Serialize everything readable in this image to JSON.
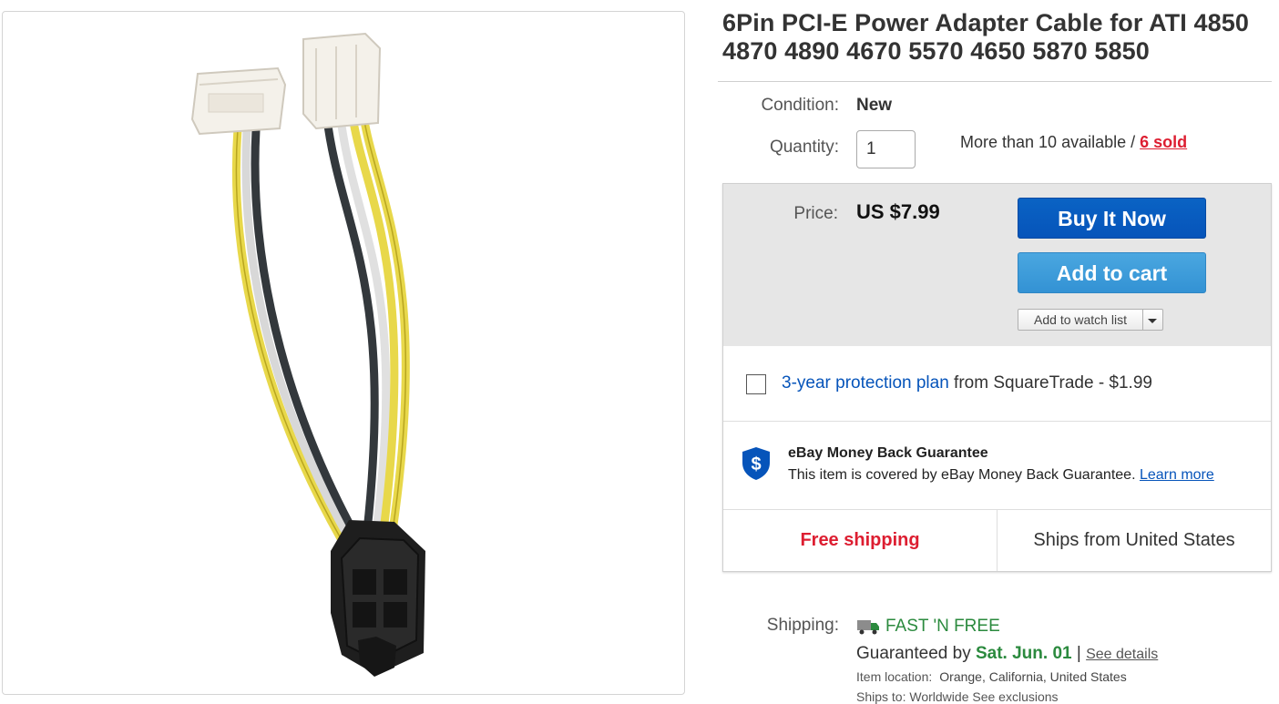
{
  "listing": {
    "title": "6Pin PCI-E Power Adapter Cable for ATI 4850 4870 4890 4670 5570 4650 5870 5850",
    "condition_label": "Condition:",
    "condition_value": "New",
    "quantity_label": "Quantity:",
    "quantity_value": "1",
    "availability_text": "More than 10 available / ",
    "sold_text": "6 sold"
  },
  "buybox": {
    "price_label": "Price:",
    "price_value": "US $7.99",
    "buy_now_label": "Buy It Now",
    "add_to_cart_label": "Add to cart",
    "watch_label": "Add to watch list",
    "protection_link": "3-year protection plan",
    "protection_rest": " from SquareTrade - $1.99",
    "mbg_title": "eBay Money Back Guarantee",
    "mbg_body": "This item is covered by eBay Money Back Guarantee. ",
    "mbg_learn_more": "Learn more",
    "free_shipping": "Free shipping",
    "ships_from": "Ships from United States"
  },
  "shipping": {
    "label": "Shipping:",
    "fast_n_free": "FAST 'N FREE",
    "guaranteed_by": "Guaranteed by ",
    "guaranteed_date": "Sat. Jun. 01",
    "separator": " | ",
    "see_details": "See details",
    "item_location_label": "Item location:",
    "item_location_value": "Orange, California, United States",
    "ships_to_label": "Ships to:",
    "ships_to_value": "Worldwide",
    "see_exclusions": "See exclusions"
  },
  "colors": {
    "buy_now": "#0654ba",
    "add_to_cart": "#3392d4",
    "free_shipping": "#dd1e31",
    "fast_n_free": "#2b8a3e",
    "link": "#0654ba"
  },
  "icons": [
    "shield-dollar-icon",
    "truck-icon",
    "chevron-down-icon"
  ]
}
